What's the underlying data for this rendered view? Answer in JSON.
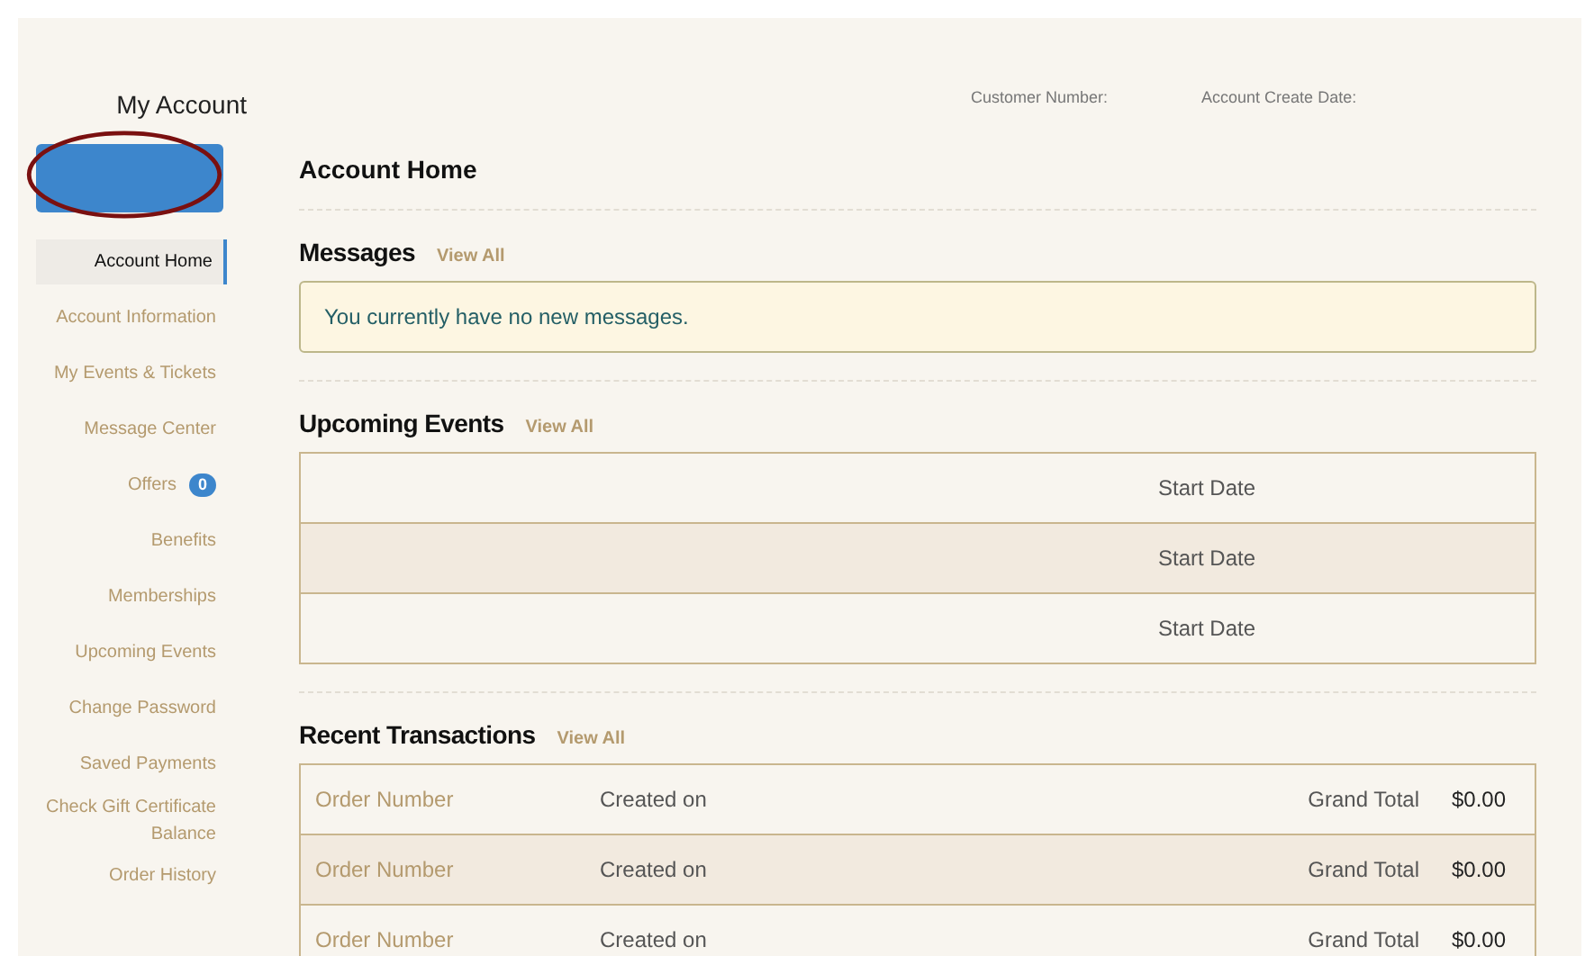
{
  "sidebar": {
    "title": "My Account",
    "items": [
      {
        "label": "Account Home",
        "selected": true
      },
      {
        "label": "Account Information",
        "selected": false
      },
      {
        "label": "My Events & Tickets",
        "selected": false
      },
      {
        "label": "Message Center",
        "selected": false
      },
      {
        "label": "Offers",
        "selected": false,
        "badge": "0"
      },
      {
        "label": "Benefits",
        "selected": false
      },
      {
        "label": "Memberships",
        "selected": false
      },
      {
        "label": "Upcoming Events",
        "selected": false
      },
      {
        "label": "Change Password",
        "selected": false
      },
      {
        "label": "Saved Payments",
        "selected": false
      },
      {
        "label": "Check Gift Certificate Balance",
        "selected": false
      },
      {
        "label": "Order History",
        "selected": false
      }
    ]
  },
  "header": {
    "customer_number_label": "Customer Number:",
    "account_create_date_label": "Account Create Date:"
  },
  "page_title": "Account Home",
  "messages": {
    "title": "Messages",
    "view_all": "View All",
    "notice": "You currently have no new messages."
  },
  "upcoming_events": {
    "title": "Upcoming Events",
    "view_all": "View All",
    "rows": [
      {
        "start_date": "Start Date"
      },
      {
        "start_date": "Start Date"
      },
      {
        "start_date": "Start Date"
      }
    ]
  },
  "recent_transactions": {
    "title": "Recent Transactions",
    "view_all": "View All",
    "rows": [
      {
        "order_number": "Order Number",
        "created_on": "Created on",
        "grand_total_label": "Grand Total",
        "amount": "$0.00"
      },
      {
        "order_number": "Order Number",
        "created_on": "Created on",
        "grand_total_label": "Grand Total",
        "amount": "$0.00"
      },
      {
        "order_number": "Order Number",
        "created_on": "Created on",
        "grand_total_label": "Grand Total",
        "amount": "$0.00"
      }
    ]
  }
}
